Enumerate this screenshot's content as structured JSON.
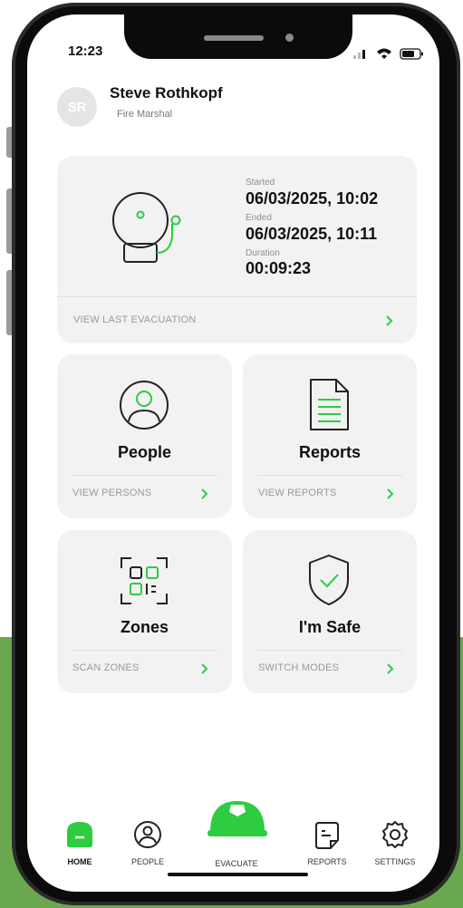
{
  "status_bar": {
    "time": "12:23"
  },
  "user": {
    "initials": "SR",
    "name": "Steve Rothkopf",
    "role": "Fire Marshal"
  },
  "last_evacuation": {
    "started_label": "Started",
    "started_value": "06/03/2025, 10:02",
    "ended_label": "Ended",
    "ended_value": "06/03/2025, 10:11",
    "duration_label": "Duration",
    "duration_value": "00:09:23",
    "link": "VIEW LAST EVACUATION"
  },
  "cards": {
    "people": {
      "title": "People",
      "link": "VIEW PERSONS"
    },
    "reports": {
      "title": "Reports",
      "link": "VIEW REPORTS"
    },
    "zones": {
      "title": "Zones",
      "link": "SCAN ZONES"
    },
    "safe": {
      "title": "I'm Safe",
      "link": "SWITCH MODES"
    }
  },
  "tabs": [
    "HOME",
    "PEOPLE",
    "EVACUATE",
    "REPORTS",
    "SETTINGS"
  ],
  "colors": {
    "accent": "#2ecc40",
    "card": "#f2f2f2",
    "background_green": "#6aa84f"
  },
  "icons": [
    "alarm-bell-icon",
    "person-icon",
    "document-icon",
    "qr-scan-icon",
    "shield-check-icon",
    "home-icon",
    "helmet-icon",
    "reports-icon",
    "gear-icon",
    "chevron-right-icon"
  ]
}
